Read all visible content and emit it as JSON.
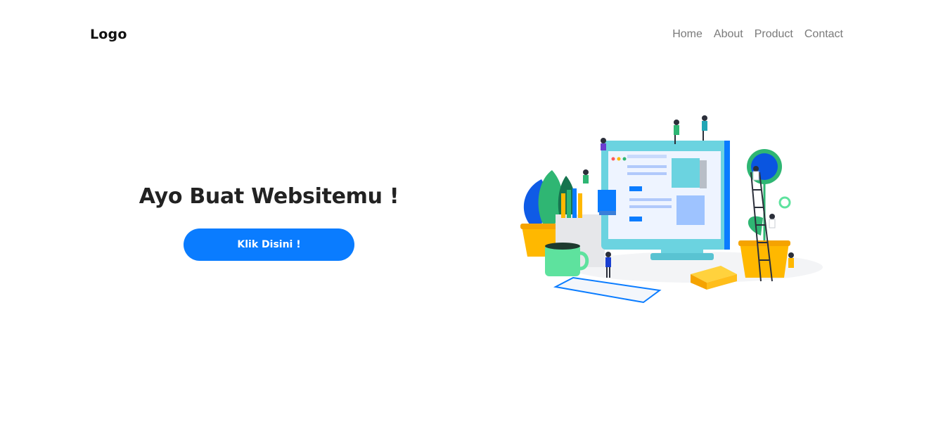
{
  "nav": {
    "logo": "Logo",
    "links": [
      "Home",
      "About",
      "Product",
      "Contact"
    ]
  },
  "hero": {
    "title": "Ayo Buat Websitemu !",
    "button_label": "Klik Disini !"
  },
  "colors": {
    "accent": "#0a7cff",
    "nav_text": "#7a7a7a",
    "heading": "#222222"
  },
  "illustration": {
    "icon": "workspace-illustration"
  }
}
